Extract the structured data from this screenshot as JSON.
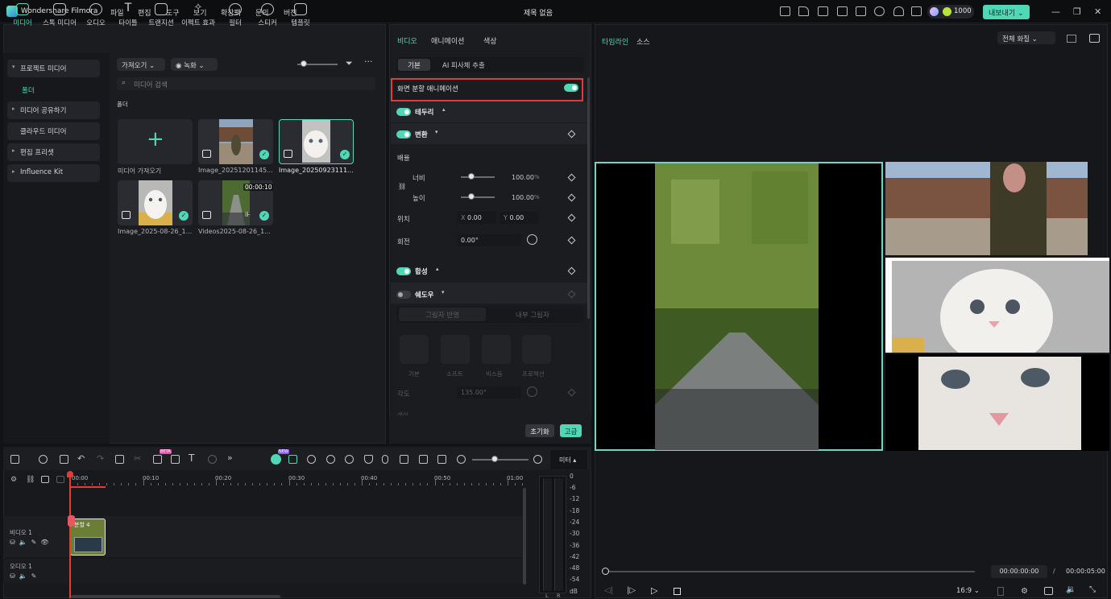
{
  "app": {
    "name": "Wondershare Filmora",
    "window_title": "제목 없음",
    "credits": "1000",
    "export_label": "내보내기"
  },
  "menu": [
    "파일",
    "편집",
    "도구",
    "보기",
    "확장팩",
    "문의",
    "버전"
  ],
  "media_toolbar": [
    "미디어",
    "스톡 미디어",
    "오디오",
    "타이틀",
    "트랜지션",
    "이펙트 효과",
    "필터",
    "스티커",
    "템플릿"
  ],
  "sidebar": {
    "project_media": "프로젝트 미디어",
    "folder": "폴더",
    "shared_media": "미디어 공유하기",
    "cloud_media": "클라우드 미디어",
    "edit_presets": "편집 프리셋",
    "influence_kit": "Influence Kit"
  },
  "media_panel": {
    "import_label": "가져오기",
    "record_label": "녹화",
    "search_placeholder": "미디어 검색",
    "folder_label": "폴더",
    "import_media": "미디어 가져오기",
    "items": [
      {
        "name": "Image_20251201145...",
        "type": "image"
      },
      {
        "name": "Image_20250923111...",
        "type": "image"
      },
      {
        "name": "Image_2025-08-26_1...",
        "type": "image"
      },
      {
        "name": "Videos2025-08-26_1...",
        "type": "video",
        "duration": "00:00:10"
      }
    ]
  },
  "inspector": {
    "tabs": [
      "비디오",
      "애니메이션",
      "색상"
    ],
    "subtabs": [
      "기본",
      "AI 피사체 추출"
    ],
    "screen_anim": "화면 분할 애니메이션",
    "border": "테두리",
    "transform": "변환",
    "scale": "배율",
    "width": "너비",
    "width_value": "100.00",
    "height": "높이",
    "height_value": "100.00",
    "percent": "%",
    "position": "위치",
    "x_label": "X",
    "x_value": "0.00",
    "y_label": "Y",
    "y_value": "0.00",
    "rotate": "회전",
    "rotate_value": "0.00°",
    "composite": "합성",
    "shadow": "쉐도우",
    "shadow_tabs": [
      "그림자 반영",
      "내부 그림자"
    ],
    "shadow_types": [
      "기본",
      "소프트",
      "비스듬",
      "프로젝션"
    ],
    "angle": "각도",
    "angle_value": "135.00°",
    "color": "색상",
    "reset": "초기화",
    "advanced": "고급"
  },
  "preview": {
    "tabs": [
      "타임라인",
      "소스"
    ],
    "quality": "전체 화질",
    "ratio": "16:9",
    "current_time": "00:00:00:00",
    "sep": "/",
    "total_time": "00:00:05:00"
  },
  "timeline": {
    "ruler": [
      "00:00",
      "00:10",
      "00:20",
      "00:30",
      "00:40",
      "00:50",
      "01:00"
    ],
    "meter_label": "미터",
    "meter_scale": [
      "0",
      "-6",
      "-12",
      "-18",
      "-24",
      "-30",
      "-36",
      "-42",
      "-48",
      "-54",
      "dB"
    ],
    "meter_lr": [
      "L",
      "R"
    ],
    "video_track": "비디오 1",
    "audio_track": "오디오 1",
    "clip_label": "분할 4",
    "badges": {
      "new": "NEW",
      "beta": "BETA"
    }
  },
  "colors": {
    "accent": "#50d8b6",
    "highlight": "#e53a3a",
    "panel": "#1b1c20"
  }
}
